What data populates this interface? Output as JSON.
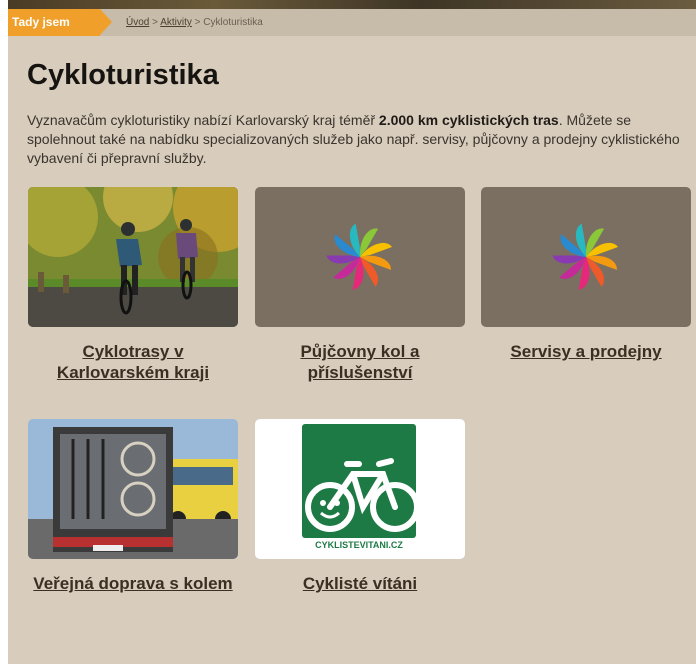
{
  "breadcrumb": {
    "here_label": "Tady jsem",
    "items": [
      "Úvod",
      "Aktivity"
    ],
    "separator": ">",
    "current": "Cykloturistika"
  },
  "page": {
    "title": "Cykloturistika",
    "intro_before": "Vyznavačům cykloturistiky nabízí Karlovarský kraj téměř ",
    "intro_bold": "2.000 km cyklistických tras",
    "intro_after": ". Můžete se spolehnout také na nabídku specializovaných služeb jako např. servisy, půjčovny a prodejny cyklistického vybavení či přepravní služby."
  },
  "cards": [
    {
      "title": "Cyklotrasy v Karlovarském kraji",
      "image": "cyclists-photo"
    },
    {
      "title": "Půjčovny kol a příslušenství",
      "image": "pinwheel-logo"
    },
    {
      "title": "Servisy a prodejny",
      "image": "pinwheel-logo"
    },
    {
      "title": "Veřejná doprava s kolem",
      "image": "bus-bike-rack-photo"
    },
    {
      "title": "Cyklisté vítáni",
      "image": "cyklistevitani-logo",
      "logo_text": "CYKLISTEVITANI.CZ"
    }
  ],
  "colors": {
    "accent_orange": "#f0a02a",
    "panel_bg": "#d8ccbd",
    "pinwheel_bg": "#7a6f60",
    "logo_green": "#1e7a45"
  }
}
